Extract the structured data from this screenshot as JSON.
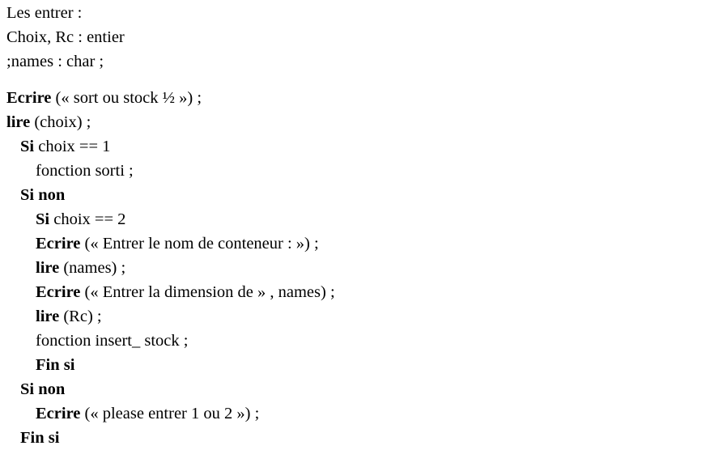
{
  "declarations": [
    "Les entrer :",
    "Choix, Rc : entier",
    ";names : char ;"
  ],
  "code": [
    {
      "indent": 0,
      "kw": "Ecrire",
      "rest": " (« sort ou stock ½ ») ;"
    },
    {
      "indent": 0,
      "kw": "lire",
      "rest": " (choix) ;"
    },
    {
      "indent": 1,
      "kw": "Si",
      "rest": " choix == 1"
    },
    {
      "indent": 2,
      "kw": "",
      "rest": "fonction sorti ;"
    },
    {
      "indent": 1,
      "kw": "Si non",
      "rest": ""
    },
    {
      "indent": 2,
      "kw": "Si",
      "rest": " choix == 2"
    },
    {
      "indent": 2,
      "kw": "Ecrire",
      "rest": " (« Entrer le nom de conteneur : ») ;"
    },
    {
      "indent": 2,
      "kw": "lire",
      "rest": " (names) ;"
    },
    {
      "indent": 2,
      "kw": "Ecrire",
      "rest": " (« Entrer la dimension de » , names) ;"
    },
    {
      "indent": 2,
      "kw": "lire",
      "rest": " (Rc) ;"
    },
    {
      "indent": 2,
      "kw": "",
      "rest": "fonction insert_ stock ;"
    },
    {
      "indent": 2,
      "kw": "Fin si",
      "rest": ""
    },
    {
      "indent": 1,
      "kw": "Si non",
      "rest": ""
    },
    {
      "indent": 2,
      "kw": "Ecrire",
      "rest": " (« please entrer 1 ou 2 ») ;"
    },
    {
      "indent": 1,
      "kw": "Fin si",
      "rest": ""
    }
  ]
}
